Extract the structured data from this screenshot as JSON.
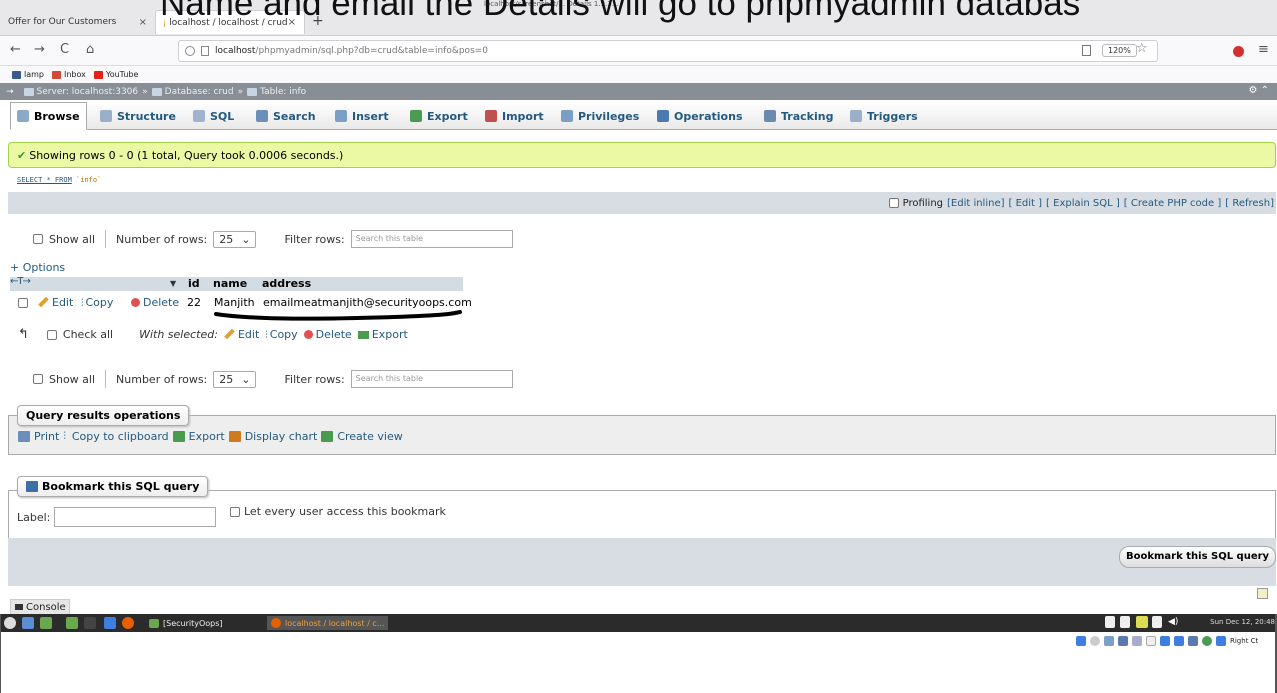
{
  "caption": "Name and email the Details will go to phpmyadmin databas",
  "caption_small": "localhost/screenshot/... Details 1.9.3...",
  "browser": {
    "tabs": [
      {
        "label": "Offer for Our Customers",
        "close": "×"
      },
      {
        "label": "localhost / localhost / crud",
        "close": "×"
      }
    ],
    "new_tab": "+",
    "back": "←",
    "forward": "→",
    "reload": "C",
    "home": "⌂",
    "url_host": "localhost",
    "url_path": "/phpmyadmin/sql.php?db=crud&table=info&pos=0",
    "zoom": "120%",
    "star": "☆",
    "menu": "≡",
    "bookmarks": [
      {
        "label": "lamp",
        "color": "#3c5a8c"
      },
      {
        "label": "Inbox",
        "color": "#d44638"
      },
      {
        "label": "YouTube",
        "color": "#e62117"
      }
    ]
  },
  "pma": {
    "breadcrumb": {
      "server": "Server: localhost:3306",
      "database": "Database: crud",
      "table": "Table: info",
      "sep": "»"
    },
    "tabs": [
      {
        "label": "Browse",
        "icon": "browse-icon",
        "color": "#8ca8c8"
      },
      {
        "label": "Structure",
        "icon": "structure-icon",
        "color": "#9ab0c8"
      },
      {
        "label": "SQL",
        "icon": "sql-icon",
        "color": "#a0b4d0"
      },
      {
        "label": "Search",
        "icon": "search-icon",
        "color": "#6b8fb8"
      },
      {
        "label": "Insert",
        "icon": "insert-icon",
        "color": "#7aa0c8"
      },
      {
        "label": "Export",
        "icon": "export-icon",
        "color": "#4a9a50"
      },
      {
        "label": "Import",
        "icon": "import-icon",
        "color": "#c05050"
      },
      {
        "label": "Privileges",
        "icon": "privileges-icon",
        "color": "#7a9ec4"
      },
      {
        "label": "Operations",
        "icon": "operations-icon",
        "color": "#4a7ab0"
      },
      {
        "label": "Tracking",
        "icon": "tracking-icon",
        "color": "#6a8ab0"
      },
      {
        "label": "Triggers",
        "icon": "triggers-icon",
        "color": "#9ab0c8"
      }
    ],
    "success_message": "Showing rows 0 - 0 (1 total, Query took 0.0006 seconds.)",
    "sql_query": {
      "keywords": "SELECT * FROM",
      "table": "`info`"
    },
    "profiling": {
      "label": "Profiling",
      "links": [
        "[Edit inline]",
        "[ Edit ]",
        "[ Explain SQL ]",
        "[ Create PHP code ]",
        "[ Refresh]"
      ]
    },
    "nav": {
      "show_all": "Show all",
      "number_of_rows": "Number of rows:",
      "rows_value": "25",
      "filter_rows": "Filter rows:",
      "filter_placeholder": "Search this table"
    },
    "options_link": "+ Options",
    "column_arrows": "←T→",
    "columns": [
      "id",
      "name",
      "address"
    ],
    "rows": [
      {
        "edit": "Edit",
        "copy": "Copy",
        "delete": "Delete",
        "id": "22",
        "name": "Manjith",
        "address": "emailmeatmanjith@securityoops.com"
      }
    ],
    "bulk": {
      "check_all": "Check all",
      "with_selected": "With selected:",
      "edit": "Edit",
      "copy": "Copy",
      "delete": "Delete",
      "export": "Export"
    },
    "query_results_operations": {
      "title": "Query results operations",
      "links": [
        {
          "label": "Print",
          "icon": "print-icon",
          "color": "#6b8fb8"
        },
        {
          "label": "Copy to clipboard",
          "icon": "copy-icon",
          "color": "#235a81"
        },
        {
          "label": "Export",
          "icon": "export-icon",
          "color": "#4a9a50"
        },
        {
          "label": "Display chart",
          "icon": "chart-icon",
          "color": "#d07a20"
        },
        {
          "label": "Create view",
          "icon": "view-icon",
          "color": "#4a9a50"
        }
      ]
    },
    "bookmark": {
      "title": "Bookmark this SQL query",
      "label_text": "Label:",
      "every_user": "Let every user access this bookmark",
      "button": "Bookmark this SQL query"
    },
    "console": "Console"
  },
  "taskbar": {
    "apps": [
      {
        "label": "[SecurityOops]"
      },
      {
        "label": "localhost / localhost / c..."
      }
    ],
    "clock": "Sun Dec 12, 20:48",
    "tray_label": "Right Ct"
  }
}
